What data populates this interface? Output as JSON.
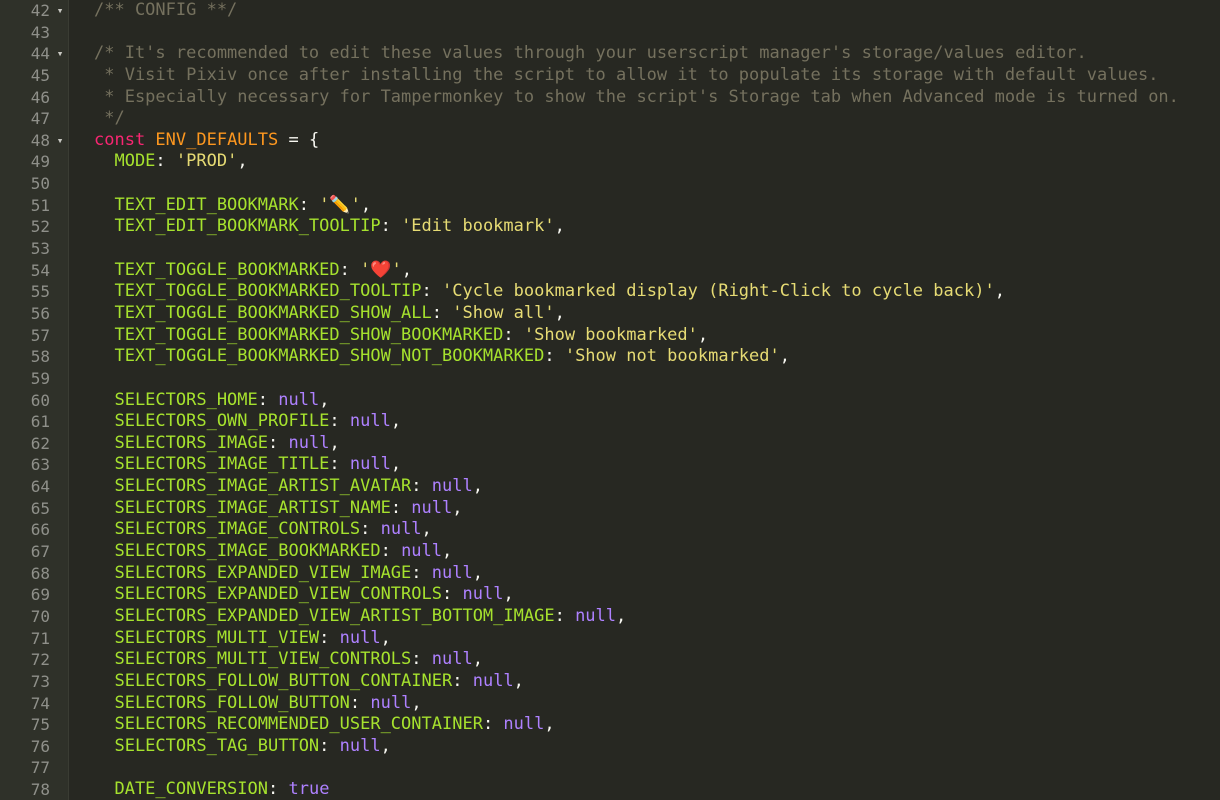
{
  "lines": [
    {
      "n": "42",
      "fold": "▾",
      "tokens": [
        {
          "c": "cm",
          "t": "/** CONFIG **/"
        }
      ]
    },
    {
      "n": "43",
      "tokens": []
    },
    {
      "n": "44",
      "fold": "▾",
      "tokens": [
        {
          "c": "cm",
          "t": "/* It's recommended to edit these values through your userscript manager's storage/values editor."
        }
      ]
    },
    {
      "n": "45",
      "tokens": [
        {
          "c": "cm",
          "t": " * Visit Pixiv once after installing the script to allow it to populate its storage with default values."
        }
      ]
    },
    {
      "n": "46",
      "tokens": [
        {
          "c": "cm",
          "t": " * Especially necessary for Tampermonkey to show the script's Storage tab when Advanced mode is turned on."
        }
      ]
    },
    {
      "n": "47",
      "tokens": [
        {
          "c": "cm",
          "t": " */"
        }
      ]
    },
    {
      "n": "48",
      "fold": "▾",
      "tokens": [
        {
          "c": "kw",
          "t": "const "
        },
        {
          "c": "cn",
          "t": "ENV_DEFAULTS"
        },
        {
          "c": "pl",
          "t": " = {"
        }
      ]
    },
    {
      "n": "49",
      "tokens": [
        {
          "c": "pr",
          "t": "  MODE"
        },
        {
          "c": "pl",
          "t": ": "
        },
        {
          "c": "st",
          "t": "'PROD'"
        },
        {
          "c": "pl",
          "t": ","
        }
      ]
    },
    {
      "n": "50",
      "tokens": []
    },
    {
      "n": "51",
      "tokens": [
        {
          "c": "pr",
          "t": "  TEXT_EDIT_BOOKMARK"
        },
        {
          "c": "pl",
          "t": ": "
        },
        {
          "c": "st",
          "t": "'✏️'"
        },
        {
          "c": "pl",
          "t": ","
        }
      ]
    },
    {
      "n": "52",
      "tokens": [
        {
          "c": "pr",
          "t": "  TEXT_EDIT_BOOKMARK_TOOLTIP"
        },
        {
          "c": "pl",
          "t": ": "
        },
        {
          "c": "st",
          "t": "'Edit bookmark'"
        },
        {
          "c": "pl",
          "t": ","
        }
      ]
    },
    {
      "n": "53",
      "tokens": []
    },
    {
      "n": "54",
      "tokens": [
        {
          "c": "pr",
          "t": "  TEXT_TOGGLE_BOOKMARKED"
        },
        {
          "c": "pl",
          "t": ": "
        },
        {
          "c": "st",
          "t": "'❤️'"
        },
        {
          "c": "pl",
          "t": ","
        }
      ]
    },
    {
      "n": "55",
      "tokens": [
        {
          "c": "pr",
          "t": "  TEXT_TOGGLE_BOOKMARKED_TOOLTIP"
        },
        {
          "c": "pl",
          "t": ": "
        },
        {
          "c": "st",
          "t": "'Cycle bookmarked display (Right-Click to cycle back)'"
        },
        {
          "c": "pl",
          "t": ","
        }
      ]
    },
    {
      "n": "56",
      "tokens": [
        {
          "c": "pr",
          "t": "  TEXT_TOGGLE_BOOKMARKED_SHOW_ALL"
        },
        {
          "c": "pl",
          "t": ": "
        },
        {
          "c": "st",
          "t": "'Show all'"
        },
        {
          "c": "pl",
          "t": ","
        }
      ]
    },
    {
      "n": "57",
      "tokens": [
        {
          "c": "pr",
          "t": "  TEXT_TOGGLE_BOOKMARKED_SHOW_BOOKMARKED"
        },
        {
          "c": "pl",
          "t": ": "
        },
        {
          "c": "st",
          "t": "'Show bookmarked'"
        },
        {
          "c": "pl",
          "t": ","
        }
      ]
    },
    {
      "n": "58",
      "tokens": [
        {
          "c": "pr",
          "t": "  TEXT_TOGGLE_BOOKMARKED_SHOW_NOT_BOOKMARKED"
        },
        {
          "c": "pl",
          "t": ": "
        },
        {
          "c": "st",
          "t": "'Show not bookmarked'"
        },
        {
          "c": "pl",
          "t": ","
        }
      ]
    },
    {
      "n": "59",
      "tokens": []
    },
    {
      "n": "60",
      "tokens": [
        {
          "c": "pr",
          "t": "  SELECTORS_HOME"
        },
        {
          "c": "pl",
          "t": ": "
        },
        {
          "c": "nu",
          "t": "null"
        },
        {
          "c": "pl",
          "t": ","
        }
      ]
    },
    {
      "n": "61",
      "tokens": [
        {
          "c": "pr",
          "t": "  SELECTORS_OWN_PROFILE"
        },
        {
          "c": "pl",
          "t": ": "
        },
        {
          "c": "nu",
          "t": "null"
        },
        {
          "c": "pl",
          "t": ","
        }
      ]
    },
    {
      "n": "62",
      "tokens": [
        {
          "c": "pr",
          "t": "  SELECTORS_IMAGE"
        },
        {
          "c": "pl",
          "t": ": "
        },
        {
          "c": "nu",
          "t": "null"
        },
        {
          "c": "pl",
          "t": ","
        }
      ]
    },
    {
      "n": "63",
      "tokens": [
        {
          "c": "pr",
          "t": "  SELECTORS_IMAGE_TITLE"
        },
        {
          "c": "pl",
          "t": ": "
        },
        {
          "c": "nu",
          "t": "null"
        },
        {
          "c": "pl",
          "t": ","
        }
      ]
    },
    {
      "n": "64",
      "tokens": [
        {
          "c": "pr",
          "t": "  SELECTORS_IMAGE_ARTIST_AVATAR"
        },
        {
          "c": "pl",
          "t": ": "
        },
        {
          "c": "nu",
          "t": "null"
        },
        {
          "c": "pl",
          "t": ","
        }
      ]
    },
    {
      "n": "65",
      "tokens": [
        {
          "c": "pr",
          "t": "  SELECTORS_IMAGE_ARTIST_NAME"
        },
        {
          "c": "pl",
          "t": ": "
        },
        {
          "c": "nu",
          "t": "null"
        },
        {
          "c": "pl",
          "t": ","
        }
      ]
    },
    {
      "n": "66",
      "tokens": [
        {
          "c": "pr",
          "t": "  SELECTORS_IMAGE_CONTROLS"
        },
        {
          "c": "pl",
          "t": ": "
        },
        {
          "c": "nu",
          "t": "null"
        },
        {
          "c": "pl",
          "t": ","
        }
      ]
    },
    {
      "n": "67",
      "tokens": [
        {
          "c": "pr",
          "t": "  SELECTORS_IMAGE_BOOKMARKED"
        },
        {
          "c": "pl",
          "t": ": "
        },
        {
          "c": "nu",
          "t": "null"
        },
        {
          "c": "pl",
          "t": ","
        }
      ]
    },
    {
      "n": "68",
      "tokens": [
        {
          "c": "pr",
          "t": "  SELECTORS_EXPANDED_VIEW_IMAGE"
        },
        {
          "c": "pl",
          "t": ": "
        },
        {
          "c": "nu",
          "t": "null"
        },
        {
          "c": "pl",
          "t": ","
        }
      ]
    },
    {
      "n": "69",
      "tokens": [
        {
          "c": "pr",
          "t": "  SELECTORS_EXPANDED_VIEW_CONTROLS"
        },
        {
          "c": "pl",
          "t": ": "
        },
        {
          "c": "nu",
          "t": "null"
        },
        {
          "c": "pl",
          "t": ","
        }
      ]
    },
    {
      "n": "70",
      "tokens": [
        {
          "c": "pr",
          "t": "  SELECTORS_EXPANDED_VIEW_ARTIST_BOTTOM_IMAGE"
        },
        {
          "c": "pl",
          "t": ": "
        },
        {
          "c": "nu",
          "t": "null"
        },
        {
          "c": "pl",
          "t": ","
        }
      ]
    },
    {
      "n": "71",
      "tokens": [
        {
          "c": "pr",
          "t": "  SELECTORS_MULTI_VIEW"
        },
        {
          "c": "pl",
          "t": ": "
        },
        {
          "c": "nu",
          "t": "null"
        },
        {
          "c": "pl",
          "t": ","
        }
      ]
    },
    {
      "n": "72",
      "tokens": [
        {
          "c": "pr",
          "t": "  SELECTORS_MULTI_VIEW_CONTROLS"
        },
        {
          "c": "pl",
          "t": ": "
        },
        {
          "c": "nu",
          "t": "null"
        },
        {
          "c": "pl",
          "t": ","
        }
      ]
    },
    {
      "n": "73",
      "tokens": [
        {
          "c": "pr",
          "t": "  SELECTORS_FOLLOW_BUTTON_CONTAINER"
        },
        {
          "c": "pl",
          "t": ": "
        },
        {
          "c": "nu",
          "t": "null"
        },
        {
          "c": "pl",
          "t": ","
        }
      ]
    },
    {
      "n": "74",
      "tokens": [
        {
          "c": "pr",
          "t": "  SELECTORS_FOLLOW_BUTTON"
        },
        {
          "c": "pl",
          "t": ": "
        },
        {
          "c": "nu",
          "t": "null"
        },
        {
          "c": "pl",
          "t": ","
        }
      ]
    },
    {
      "n": "75",
      "tokens": [
        {
          "c": "pr",
          "t": "  SELECTORS_RECOMMENDED_USER_CONTAINER"
        },
        {
          "c": "pl",
          "t": ": "
        },
        {
          "c": "nu",
          "t": "null"
        },
        {
          "c": "pl",
          "t": ","
        }
      ]
    },
    {
      "n": "76",
      "tokens": [
        {
          "c": "pr",
          "t": "  SELECTORS_TAG_BUTTON"
        },
        {
          "c": "pl",
          "t": ": "
        },
        {
          "c": "nu",
          "t": "null"
        },
        {
          "c": "pl",
          "t": ","
        }
      ]
    },
    {
      "n": "77",
      "tokens": []
    },
    {
      "n": "78",
      "tokens": [
        {
          "c": "pr",
          "t": "  DATE_CONVERSION"
        },
        {
          "c": "pl",
          "t": ": "
        },
        {
          "c": "nu",
          "t": "true"
        }
      ]
    }
  ]
}
